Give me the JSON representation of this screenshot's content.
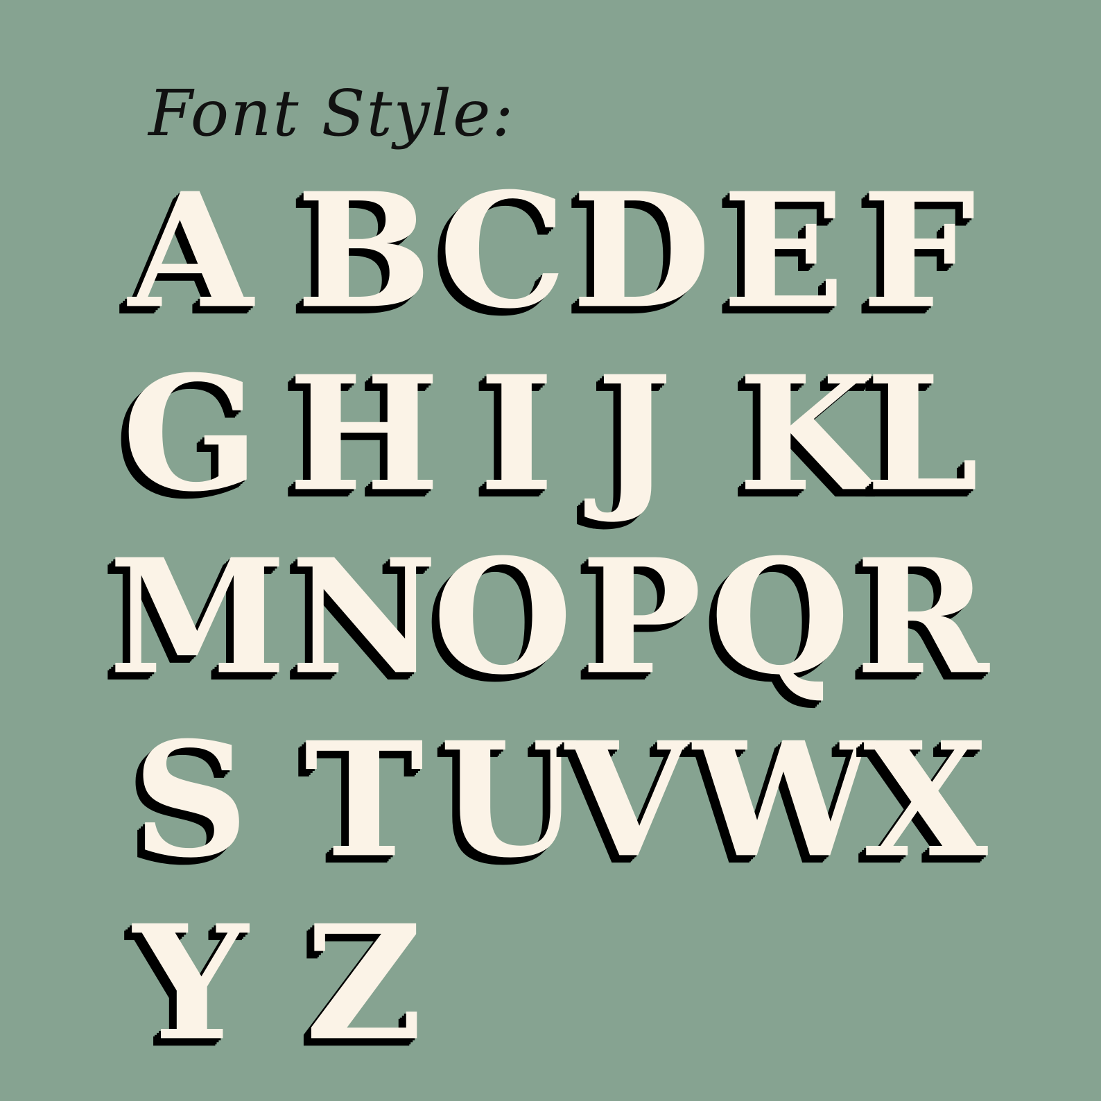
{
  "title": "Font Style:",
  "letters": [
    "A",
    "B",
    "C",
    "D",
    "E",
    "F",
    "G",
    "H",
    "I",
    "J",
    "K",
    "L",
    "M",
    "N",
    "O",
    "P",
    "Q",
    "R",
    "S",
    "T",
    "U",
    "V",
    "W",
    "X",
    "Y",
    "Z"
  ],
  "colors": {
    "background": "#86a391",
    "letter_fill": "#fbf3e7",
    "letter_shadow": "#000000",
    "title_text": "#111111"
  }
}
